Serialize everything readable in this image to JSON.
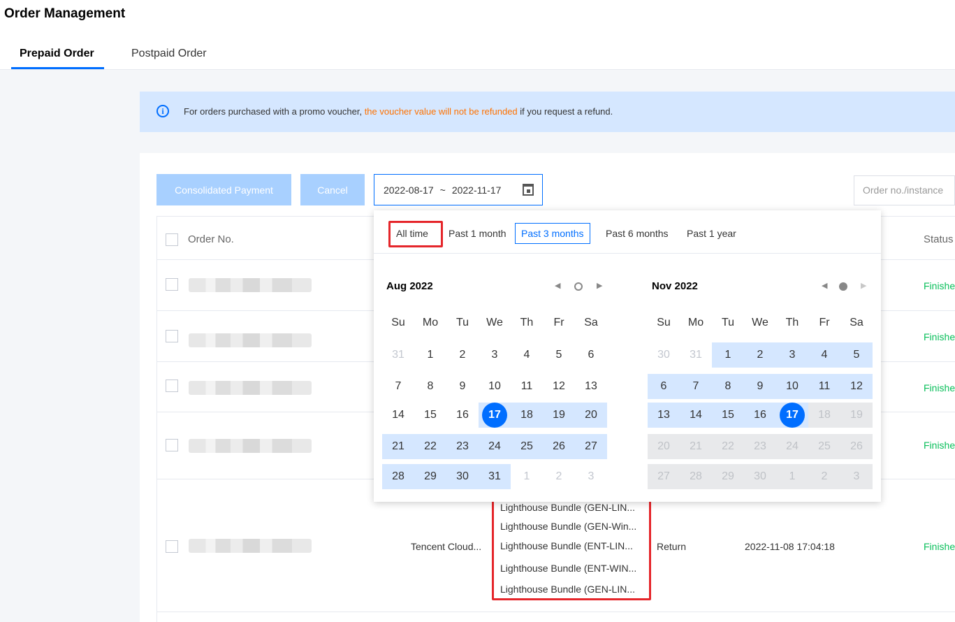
{
  "header": {
    "title": "Order Management",
    "tabs": [
      {
        "label": "Prepaid Order"
      },
      {
        "label": "Postpaid Order"
      }
    ]
  },
  "notice": {
    "icon": "info-icon",
    "text_before": "For orders purchased with a promo voucher, ",
    "text_highlight": "the voucher value will not be refunded",
    "text_after": " if you request a refund."
  },
  "toolbar": {
    "consolidated_payment_label": "Consolidated Payment",
    "cancel_label": "Cancel",
    "date_from": "2022-08-17",
    "date_separator": "~",
    "date_to": "2022-11-17",
    "search_placeholder": "Order no./instance"
  },
  "table": {
    "columns": {
      "order_no": "Order No.",
      "status": "Status"
    },
    "rows": [
      {
        "status": "Finished"
      },
      {
        "status": "Finished"
      },
      {
        "status": "Finished"
      },
      {
        "status": "Finished"
      },
      {
        "product": "Tencent Cloud...",
        "config": [
          "Lighthouse Bundle (GEN-LIN...",
          "Lighthouse Bundle (GEN-Win...",
          "Lighthouse Bundle (ENT-LIN...",
          "Lighthouse Bundle (ENT-WIN...",
          "Lighthouse Bundle (GEN-LIN..."
        ],
        "type": "Return",
        "time": "2022-11-08 17:04:18",
        "status": "Finished"
      }
    ]
  },
  "date_picker": {
    "presets": [
      "All time",
      "Past 1 month",
      "Past 3 months",
      "Past 6 months",
      "Past 1 year"
    ],
    "selected_preset": "Past 3 months",
    "weekdays": [
      "Su",
      "Mo",
      "Tu",
      "We",
      "Th",
      "Fr",
      "Sa"
    ],
    "left_month": {
      "title": "Aug 2022",
      "days": [
        [
          "31",
          "1",
          "2",
          "3",
          "4",
          "5",
          "6"
        ],
        [
          "7",
          "8",
          "9",
          "10",
          "11",
          "12",
          "13"
        ],
        [
          "14",
          "15",
          "16",
          "17",
          "18",
          "19",
          "20"
        ],
        [
          "21",
          "22",
          "23",
          "24",
          "25",
          "26",
          "27"
        ],
        [
          "28",
          "29",
          "30",
          "31",
          "1",
          "2",
          "3"
        ]
      ]
    },
    "right_month": {
      "title": "Nov 2022",
      "days": [
        [
          "30",
          "31",
          "1",
          "2",
          "3",
          "4",
          "5"
        ],
        [
          "6",
          "7",
          "8",
          "9",
          "10",
          "11",
          "12"
        ],
        [
          "13",
          "14",
          "15",
          "16",
          "17",
          "18",
          "19"
        ],
        [
          "20",
          "21",
          "22",
          "23",
          "24",
          "25",
          "26"
        ],
        [
          "27",
          "28",
          "29",
          "30",
          "1",
          "2",
          "3"
        ]
      ]
    },
    "range_start": "17",
    "range_end": "17"
  },
  "colors": {
    "accent": "#006eff",
    "highlight_box": "#e5262b",
    "status_finished": "#0abf5b",
    "notice_highlight": "#ff7200"
  }
}
